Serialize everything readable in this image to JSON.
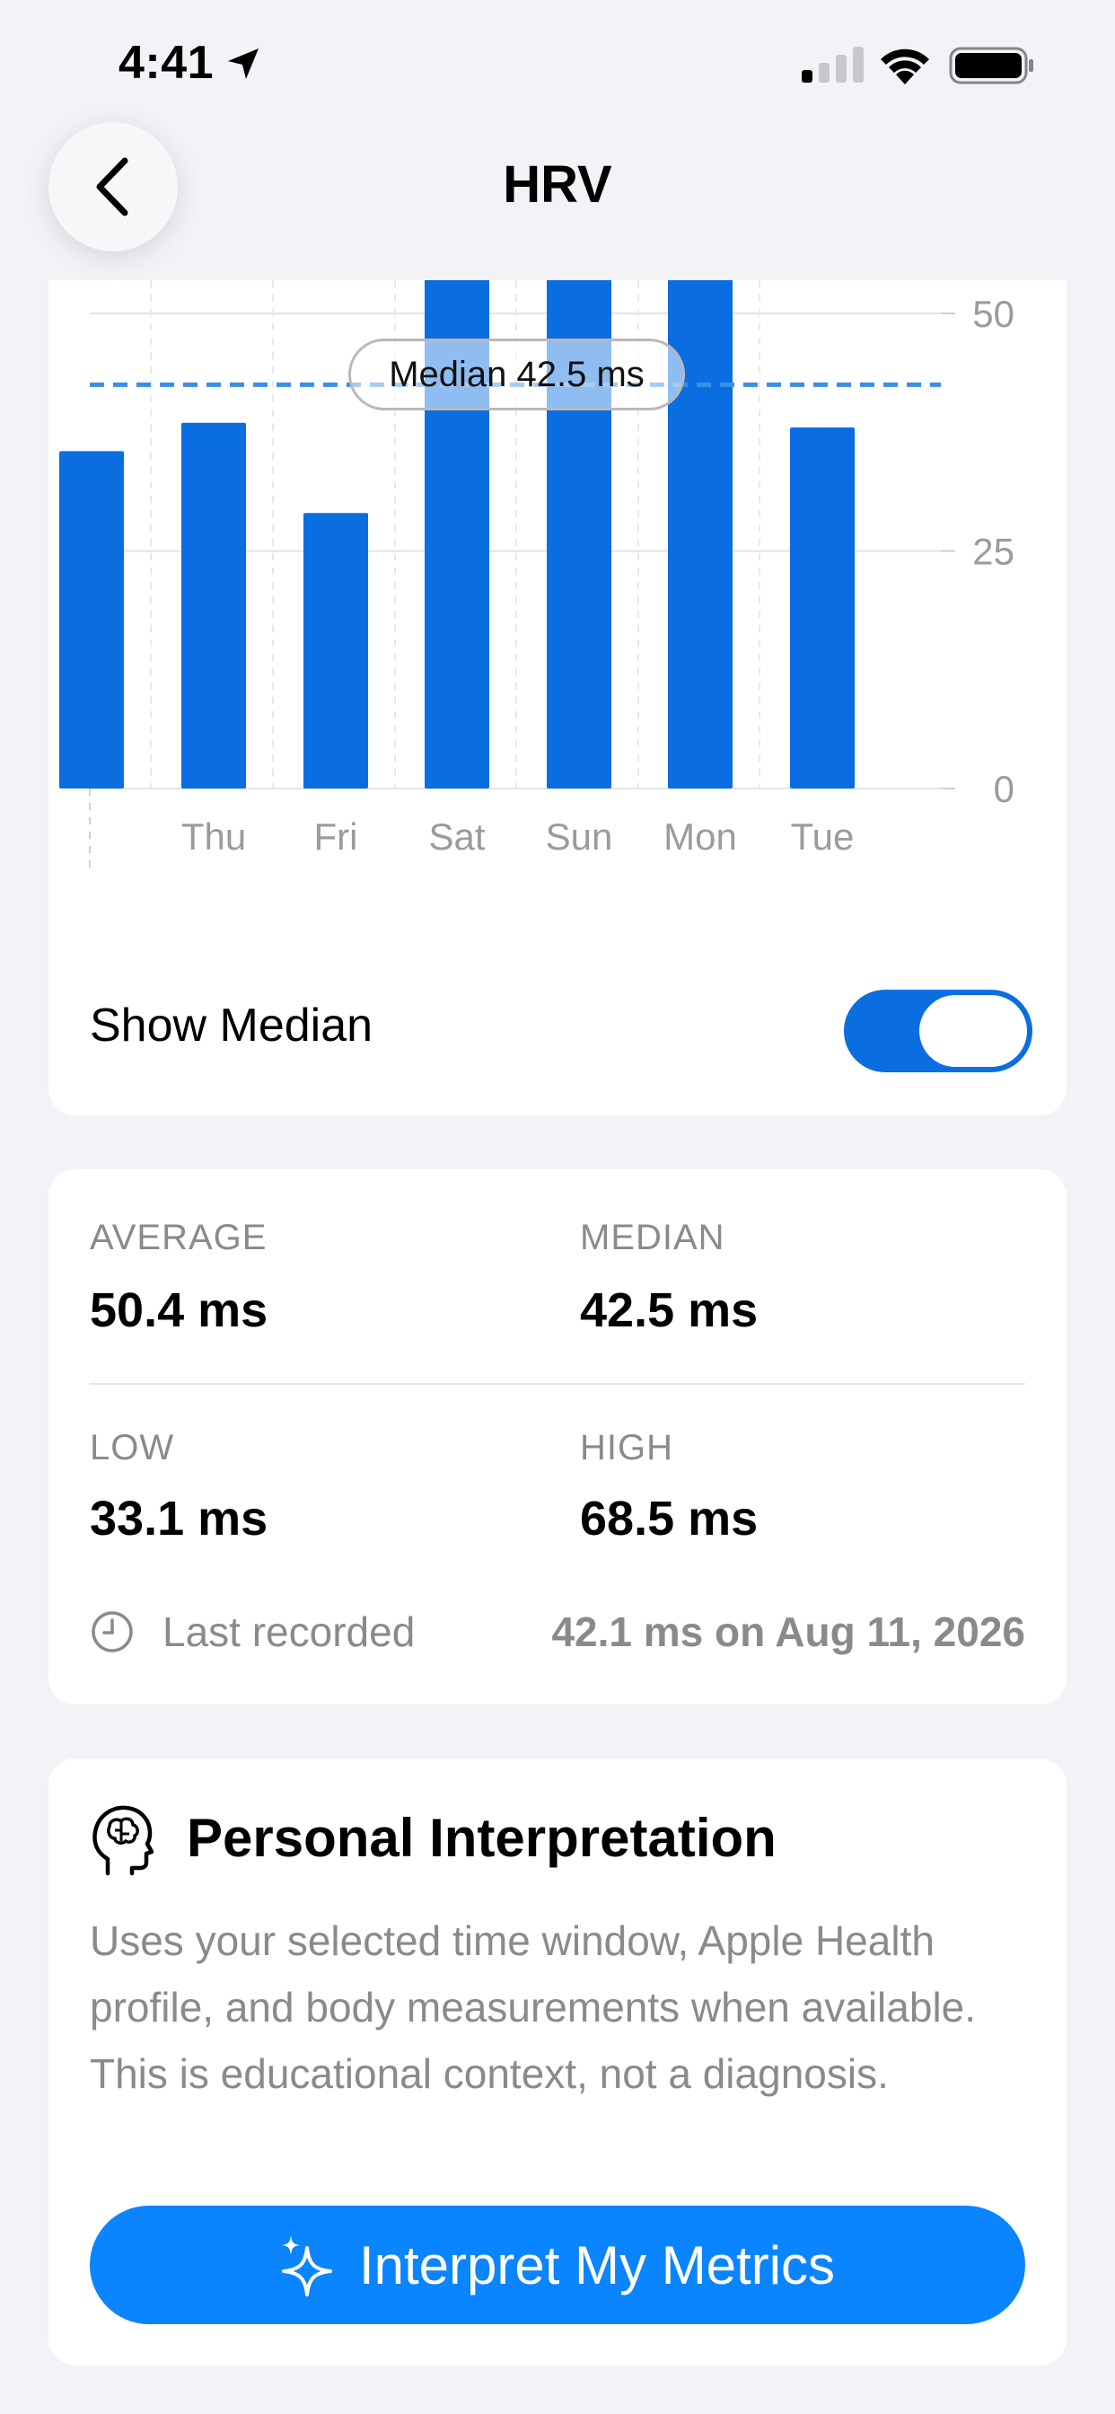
{
  "status_bar": {
    "time": "4:41"
  },
  "nav": {
    "title": "HRV"
  },
  "chart_data": {
    "type": "bar",
    "categories": [
      "",
      "Thu",
      "Fri",
      "Sat",
      "Sun",
      "Mon",
      "Tue"
    ],
    "values": [
      35.5,
      38.5,
      29,
      68.5,
      55,
      62,
      38
    ],
    "yticks": [
      0,
      25,
      50
    ],
    "ylim": [
      0,
      53.5
    ],
    "median": 42.5,
    "median_label": "Median 42.5 ms",
    "bar_color": "#0a6ee0",
    "median_line_color": "#3b8ee6",
    "grid": true
  },
  "toggle": {
    "label": "Show Median",
    "on": true
  },
  "stats": {
    "average_label": "AVERAGE",
    "average_value": "50.4 ms",
    "median_label": "MEDIAN",
    "median_value": "42.5 ms",
    "low_label": "LOW",
    "low_value": "33.1 ms",
    "high_label": "HIGH",
    "high_value": "68.5 ms",
    "last_recorded_label": "Last recorded",
    "last_recorded_value": "42.1 ms on Aug 11, 2026"
  },
  "interpretation": {
    "title": "Personal Interpretation",
    "description": "Uses your selected time window, Apple Health profile, and body measurements when available. This is educational context, not a diagnosis.",
    "button_label": "Interpret My Metrics"
  },
  "colors": {
    "accent": "#0a84ff",
    "background": "#f2f2f7",
    "secondary_text": "#8a8a8e"
  }
}
